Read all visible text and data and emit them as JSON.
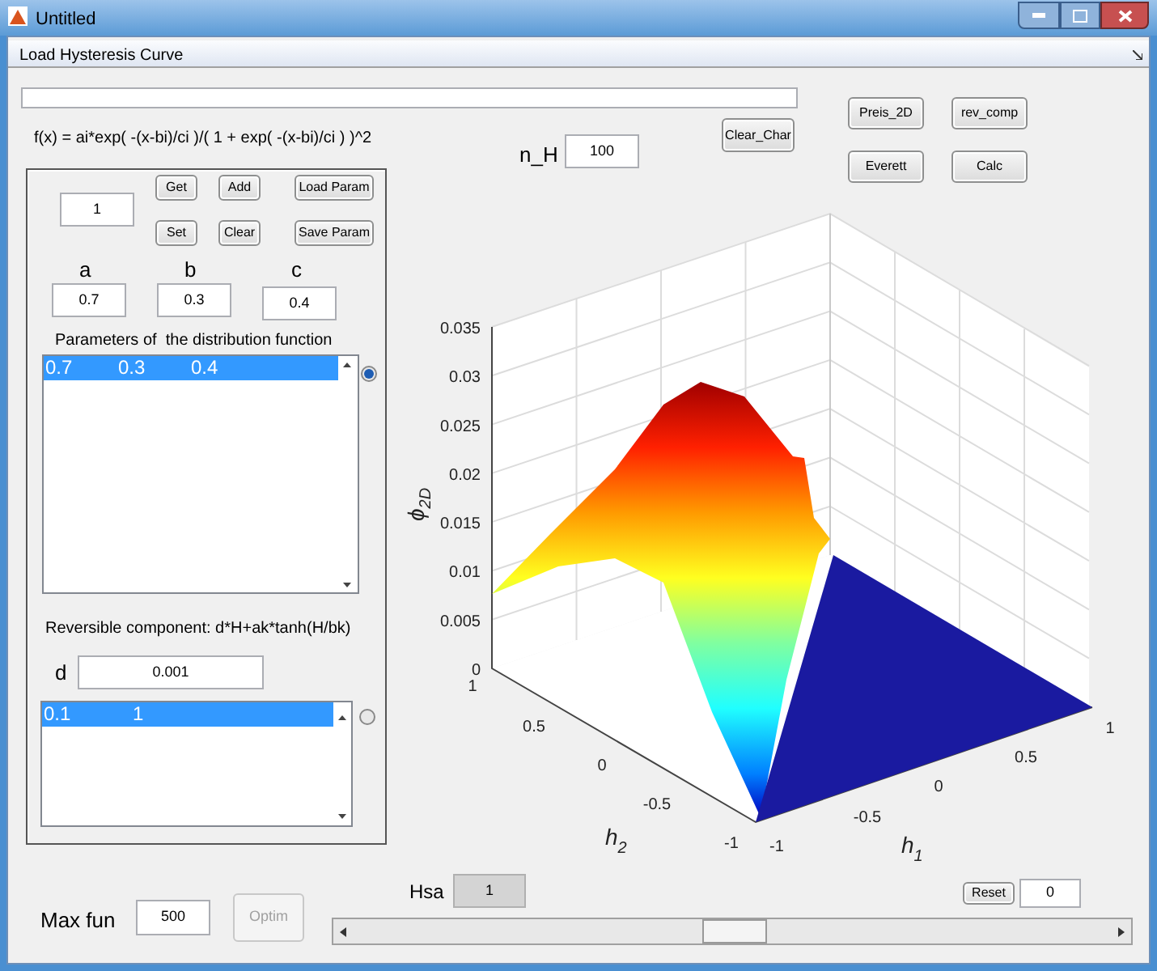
{
  "window": {
    "title": "Untitled"
  },
  "panel_title": "Load Hysteresis Curve",
  "formula": "f(x) = ai*exp( -(x-bi)/ci )/( 1 + exp( -(x-bi)/ci ) )^2",
  "clear_char_button": "Clear_Char",
  "n_h": {
    "label": "n_H",
    "value": "100"
  },
  "top_buttons": [
    "Preis_2D",
    "rev_comp",
    "Everett",
    "Calc"
  ],
  "params_panel": {
    "index_field": "1",
    "buttons": [
      "Get",
      "Add",
      "Load Param",
      "Set",
      "Clear",
      "Save Param"
    ],
    "fields": [
      {
        "label": "a",
        "value": "0.7"
      },
      {
        "label": "b",
        "value": "0.3"
      },
      {
        "label": "c",
        "value": "0.4"
      }
    ],
    "list_title": "Parameters of  the distribution function",
    "list_rows": [
      {
        "cells": [
          "0.7",
          "0.3",
          "0.4"
        ],
        "selected": true
      }
    ],
    "list_radio": {
      "selected": true
    },
    "reversible_title": "Reversible component: d*H+ak*tanh(H/bk)",
    "d": {
      "label": "d",
      "value": "0.001"
    },
    "rev_rows": [
      {
        "cells": [
          "0.1",
          "1"
        ],
        "selected": true
      }
    ],
    "rev_radio": {
      "selected": false
    }
  },
  "max_fun": {
    "label": "Max fun",
    "value": "500"
  },
  "optim_button": {
    "label": "Optim",
    "disabled": true
  },
  "hsa": {
    "label": "Hsa",
    "value": "1"
  },
  "reset_button": "Reset",
  "reset_field": "0",
  "slider": {
    "level": 0.5
  },
  "plot": {
    "zlabel": "ϕ",
    "zlabel_sub": "2D",
    "xlabel": "h",
    "xlabel_sub": "1",
    "ylabel": "h",
    "ylabel_sub": "2",
    "zticks": [
      "0.035",
      "0.03",
      "0.025",
      "0.02",
      "0.015",
      "0.01",
      "0.005",
      "0"
    ],
    "h2ticks": [
      "1",
      "0.5",
      "0",
      "-0.5",
      "-1"
    ],
    "h1ticks": [
      "-1",
      "-0.5",
      "0",
      "0.5",
      "1"
    ]
  }
}
